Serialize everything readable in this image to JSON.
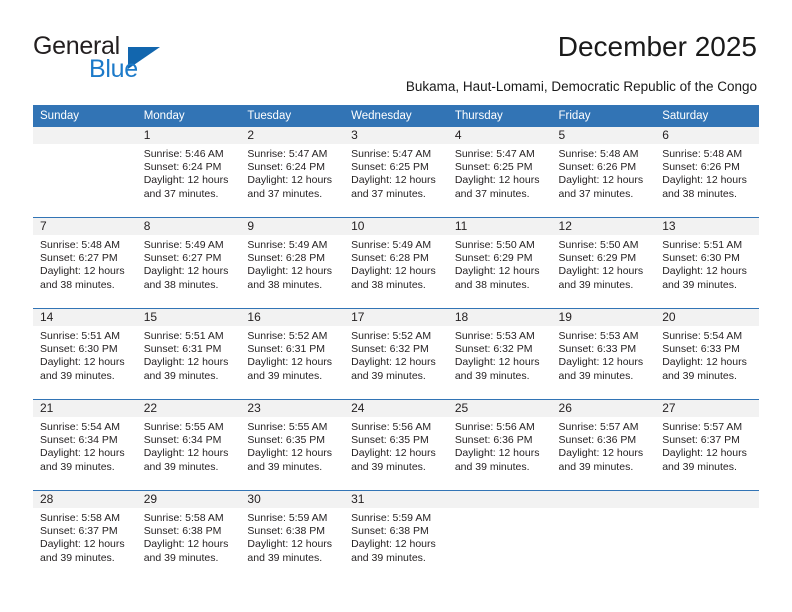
{
  "brand": {
    "name_part1": "General",
    "name_part2": "Blue",
    "triangle_color": "#1266ae",
    "blue_color": "#1c7ac9"
  },
  "header": {
    "title": "December 2025",
    "subtitle": "Bukama, Haut-Lomami, Democratic Republic of the Congo"
  },
  "calendar": {
    "header_bg": "#3274b5",
    "daynum_bg": "#f2f2f2",
    "weekday_headers": [
      "Sunday",
      "Monday",
      "Tuesday",
      "Wednesday",
      "Thursday",
      "Friday",
      "Saturday"
    ],
    "weeks": [
      [
        {
          "day": "",
          "sunrise": "",
          "sunset": "",
          "daylight1": "",
          "daylight2": ""
        },
        {
          "day": "1",
          "sunrise": "Sunrise: 5:46 AM",
          "sunset": "Sunset: 6:24 PM",
          "daylight1": "Daylight: 12 hours",
          "daylight2": "and 37 minutes."
        },
        {
          "day": "2",
          "sunrise": "Sunrise: 5:47 AM",
          "sunset": "Sunset: 6:24 PM",
          "daylight1": "Daylight: 12 hours",
          "daylight2": "and 37 minutes."
        },
        {
          "day": "3",
          "sunrise": "Sunrise: 5:47 AM",
          "sunset": "Sunset: 6:25 PM",
          "daylight1": "Daylight: 12 hours",
          "daylight2": "and 37 minutes."
        },
        {
          "day": "4",
          "sunrise": "Sunrise: 5:47 AM",
          "sunset": "Sunset: 6:25 PM",
          "daylight1": "Daylight: 12 hours",
          "daylight2": "and 37 minutes."
        },
        {
          "day": "5",
          "sunrise": "Sunrise: 5:48 AM",
          "sunset": "Sunset: 6:26 PM",
          "daylight1": "Daylight: 12 hours",
          "daylight2": "and 37 minutes."
        },
        {
          "day": "6",
          "sunrise": "Sunrise: 5:48 AM",
          "sunset": "Sunset: 6:26 PM",
          "daylight1": "Daylight: 12 hours",
          "daylight2": "and 38 minutes."
        }
      ],
      [
        {
          "day": "7",
          "sunrise": "Sunrise: 5:48 AM",
          "sunset": "Sunset: 6:27 PM",
          "daylight1": "Daylight: 12 hours",
          "daylight2": "and 38 minutes."
        },
        {
          "day": "8",
          "sunrise": "Sunrise: 5:49 AM",
          "sunset": "Sunset: 6:27 PM",
          "daylight1": "Daylight: 12 hours",
          "daylight2": "and 38 minutes."
        },
        {
          "day": "9",
          "sunrise": "Sunrise: 5:49 AM",
          "sunset": "Sunset: 6:28 PM",
          "daylight1": "Daylight: 12 hours",
          "daylight2": "and 38 minutes."
        },
        {
          "day": "10",
          "sunrise": "Sunrise: 5:49 AM",
          "sunset": "Sunset: 6:28 PM",
          "daylight1": "Daylight: 12 hours",
          "daylight2": "and 38 minutes."
        },
        {
          "day": "11",
          "sunrise": "Sunrise: 5:50 AM",
          "sunset": "Sunset: 6:29 PM",
          "daylight1": "Daylight: 12 hours",
          "daylight2": "and 38 minutes."
        },
        {
          "day": "12",
          "sunrise": "Sunrise: 5:50 AM",
          "sunset": "Sunset: 6:29 PM",
          "daylight1": "Daylight: 12 hours",
          "daylight2": "and 39 minutes."
        },
        {
          "day": "13",
          "sunrise": "Sunrise: 5:51 AM",
          "sunset": "Sunset: 6:30 PM",
          "daylight1": "Daylight: 12 hours",
          "daylight2": "and 39 minutes."
        }
      ],
      [
        {
          "day": "14",
          "sunrise": "Sunrise: 5:51 AM",
          "sunset": "Sunset: 6:30 PM",
          "daylight1": "Daylight: 12 hours",
          "daylight2": "and 39 minutes."
        },
        {
          "day": "15",
          "sunrise": "Sunrise: 5:51 AM",
          "sunset": "Sunset: 6:31 PM",
          "daylight1": "Daylight: 12 hours",
          "daylight2": "and 39 minutes."
        },
        {
          "day": "16",
          "sunrise": "Sunrise: 5:52 AM",
          "sunset": "Sunset: 6:31 PM",
          "daylight1": "Daylight: 12 hours",
          "daylight2": "and 39 minutes."
        },
        {
          "day": "17",
          "sunrise": "Sunrise: 5:52 AM",
          "sunset": "Sunset: 6:32 PM",
          "daylight1": "Daylight: 12 hours",
          "daylight2": "and 39 minutes."
        },
        {
          "day": "18",
          "sunrise": "Sunrise: 5:53 AM",
          "sunset": "Sunset: 6:32 PM",
          "daylight1": "Daylight: 12 hours",
          "daylight2": "and 39 minutes."
        },
        {
          "day": "19",
          "sunrise": "Sunrise: 5:53 AM",
          "sunset": "Sunset: 6:33 PM",
          "daylight1": "Daylight: 12 hours",
          "daylight2": "and 39 minutes."
        },
        {
          "day": "20",
          "sunrise": "Sunrise: 5:54 AM",
          "sunset": "Sunset: 6:33 PM",
          "daylight1": "Daylight: 12 hours",
          "daylight2": "and 39 minutes."
        }
      ],
      [
        {
          "day": "21",
          "sunrise": "Sunrise: 5:54 AM",
          "sunset": "Sunset: 6:34 PM",
          "daylight1": "Daylight: 12 hours",
          "daylight2": "and 39 minutes."
        },
        {
          "day": "22",
          "sunrise": "Sunrise: 5:55 AM",
          "sunset": "Sunset: 6:34 PM",
          "daylight1": "Daylight: 12 hours",
          "daylight2": "and 39 minutes."
        },
        {
          "day": "23",
          "sunrise": "Sunrise: 5:55 AM",
          "sunset": "Sunset: 6:35 PM",
          "daylight1": "Daylight: 12 hours",
          "daylight2": "and 39 minutes."
        },
        {
          "day": "24",
          "sunrise": "Sunrise: 5:56 AM",
          "sunset": "Sunset: 6:35 PM",
          "daylight1": "Daylight: 12 hours",
          "daylight2": "and 39 minutes."
        },
        {
          "day": "25",
          "sunrise": "Sunrise: 5:56 AM",
          "sunset": "Sunset: 6:36 PM",
          "daylight1": "Daylight: 12 hours",
          "daylight2": "and 39 minutes."
        },
        {
          "day": "26",
          "sunrise": "Sunrise: 5:57 AM",
          "sunset": "Sunset: 6:36 PM",
          "daylight1": "Daylight: 12 hours",
          "daylight2": "and 39 minutes."
        },
        {
          "day": "27",
          "sunrise": "Sunrise: 5:57 AM",
          "sunset": "Sunset: 6:37 PM",
          "daylight1": "Daylight: 12 hours",
          "daylight2": "and 39 minutes."
        }
      ],
      [
        {
          "day": "28",
          "sunrise": "Sunrise: 5:58 AM",
          "sunset": "Sunset: 6:37 PM",
          "daylight1": "Daylight: 12 hours",
          "daylight2": "and 39 minutes."
        },
        {
          "day": "29",
          "sunrise": "Sunrise: 5:58 AM",
          "sunset": "Sunset: 6:38 PM",
          "daylight1": "Daylight: 12 hours",
          "daylight2": "and 39 minutes."
        },
        {
          "day": "30",
          "sunrise": "Sunrise: 5:59 AM",
          "sunset": "Sunset: 6:38 PM",
          "daylight1": "Daylight: 12 hours",
          "daylight2": "and 39 minutes."
        },
        {
          "day": "31",
          "sunrise": "Sunrise: 5:59 AM",
          "sunset": "Sunset: 6:38 PM",
          "daylight1": "Daylight: 12 hours",
          "daylight2": "and 39 minutes."
        },
        {
          "day": "",
          "sunrise": "",
          "sunset": "",
          "daylight1": "",
          "daylight2": ""
        },
        {
          "day": "",
          "sunrise": "",
          "sunset": "",
          "daylight1": "",
          "daylight2": ""
        },
        {
          "day": "",
          "sunrise": "",
          "sunset": "",
          "daylight1": "",
          "daylight2": ""
        }
      ]
    ]
  }
}
